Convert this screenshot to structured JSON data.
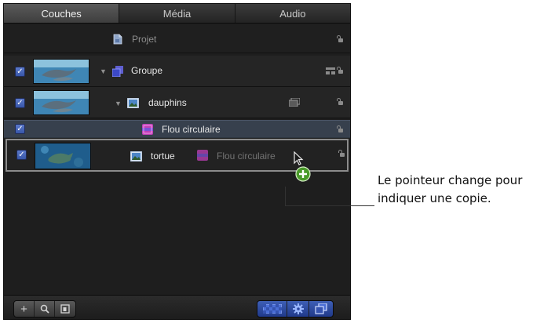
{
  "tabs": [
    "Couches",
    "Média",
    "Audio"
  ],
  "active_tab": 0,
  "layers": {
    "project": {
      "name": "Projet"
    },
    "group": {
      "name": "Groupe",
      "checked": true
    },
    "dauphins": {
      "name": "dauphins",
      "checked": true
    },
    "flou": {
      "name": "Flou circulaire",
      "checked": true
    },
    "tortue": {
      "name": "tortue",
      "checked": true,
      "drag_label": "Flou circulaire"
    }
  },
  "toolbar": {
    "left_buttons": [
      "add-icon",
      "search-icon",
      "frame-icon"
    ],
    "right_buttons": [
      "checkerboard-icon",
      "gear-icon",
      "stack-icon"
    ]
  },
  "callout": {
    "text": "Le pointeur change pour indiquer une copie."
  },
  "colors": {
    "selection": "#37404d",
    "checkbox": "#4a67bc",
    "accent_green": "#4a9a2a"
  }
}
